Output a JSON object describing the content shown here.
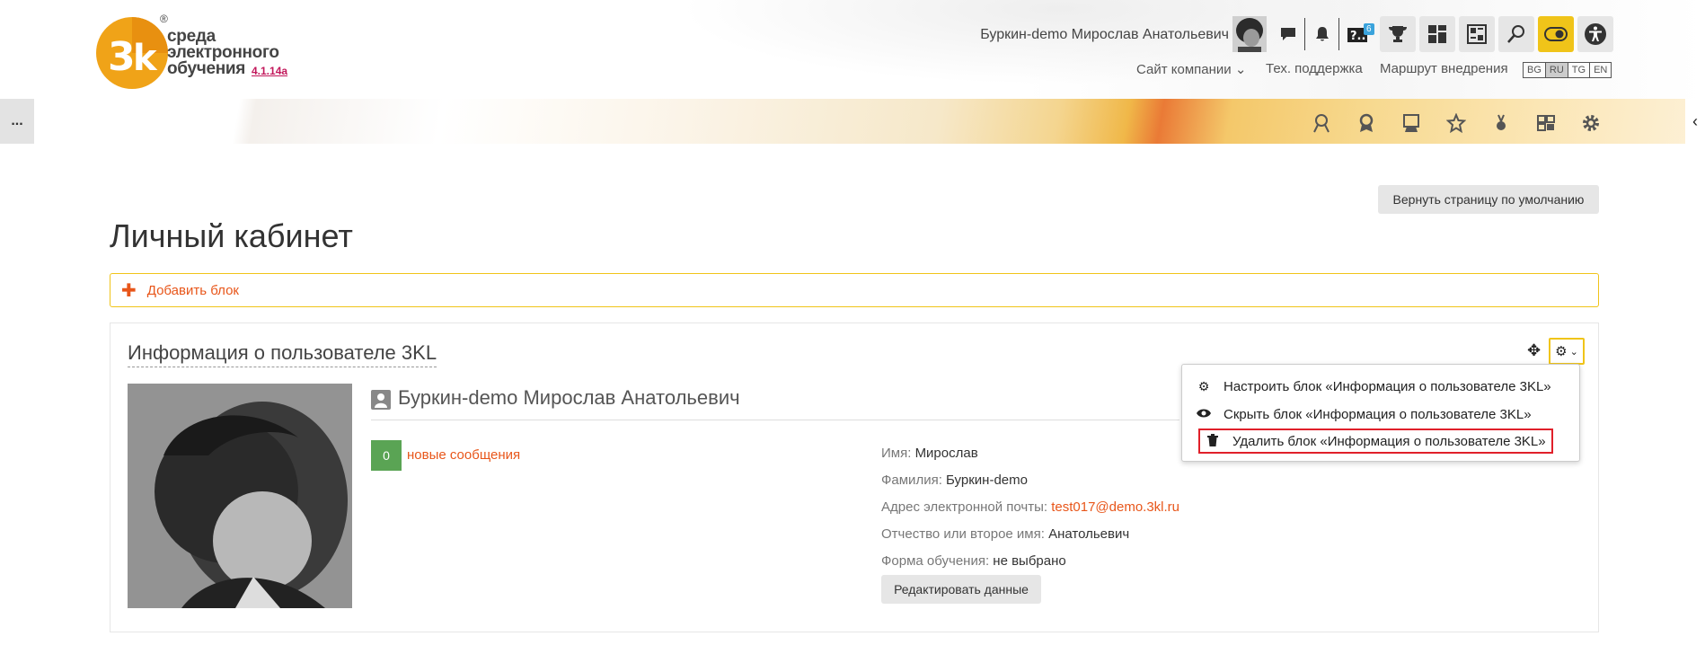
{
  "header": {
    "logo": {
      "line1": "среда",
      "line2": "электронного",
      "line3": "обучения",
      "version": "4.1.14a",
      "registered": "®"
    },
    "user_name": "Буркин-demo Мирослав Анатольевич",
    "help_badge": "6",
    "links": {
      "company": "Сайт компании",
      "support": "Тех. поддержка",
      "route": "Маршрут внедрения"
    },
    "languages": [
      "BG",
      "RU",
      "TG",
      "EN"
    ],
    "active_language": "RU"
  },
  "banner": {
    "left_button": "..."
  },
  "page": {
    "reset_button": "Вернуть страницу по умолчанию",
    "title": "Личный кабинет",
    "add_block": "Добавить блок"
  },
  "block": {
    "title": "Информация о пользователе 3KL",
    "full_name": "Буркин-demo Мирослав Анатольевич",
    "new_messages_count": "0",
    "new_messages_label": "новые сообщения",
    "fields": [
      {
        "key": "Имя:",
        "value": "Мирослав"
      },
      {
        "key": "Фамилия:",
        "value": "Буркин-demo"
      },
      {
        "key": "Адрес электронной почты:",
        "value": "test017@demo.3kl.ru"
      },
      {
        "key": "Отчество или второе имя:",
        "value": "Анатольевич"
      },
      {
        "key": "Форма обучения:",
        "value": "не выбрано"
      }
    ],
    "edit_button": "Редактировать данные"
  },
  "menu": {
    "configure": "Настроить блок «Информация о пользователе 3KL»",
    "hide": "Скрыть блок «Информация о пользователе 3KL»",
    "delete": "Удалить блок «Информация о пользователе 3KL»"
  },
  "colors": {
    "accent": "#e8561a",
    "yellow": "#f0c419",
    "green": "#5aa454",
    "highlight": "#e0202a"
  }
}
